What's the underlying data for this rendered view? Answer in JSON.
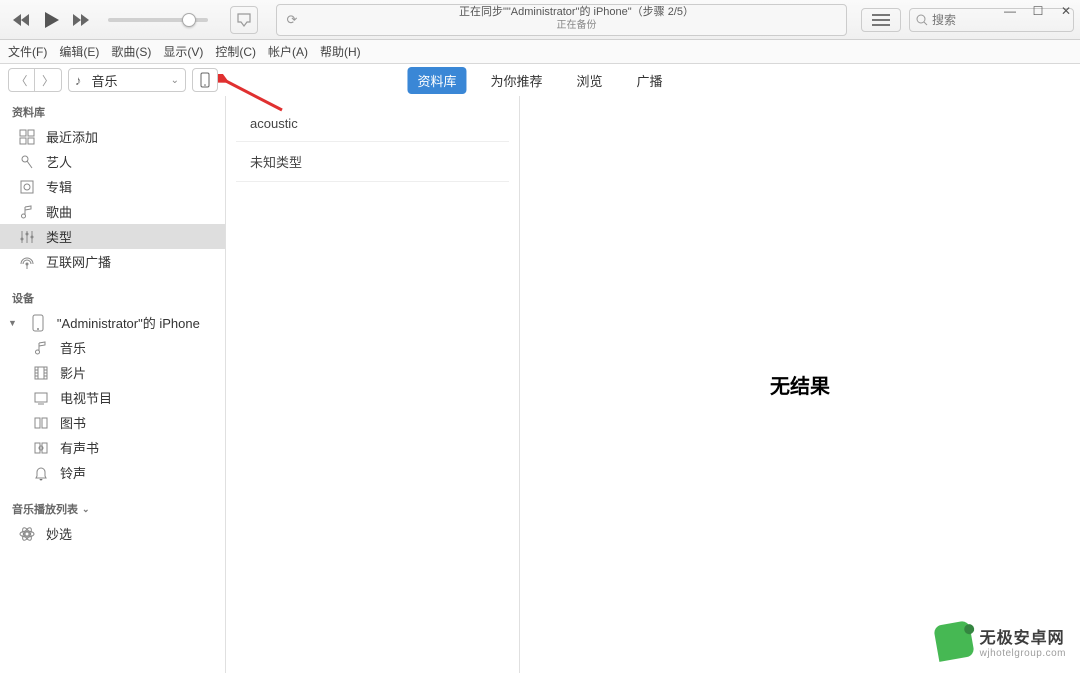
{
  "status": {
    "title": "正在同步\"\"Administrator\"的 iPhone\"（步骤 2/5）",
    "subtitle": "正在备份"
  },
  "search": {
    "placeholder": "搜索"
  },
  "menubar": [
    "文件(F)",
    "编辑(E)",
    "歌曲(S)",
    "显示(V)",
    "控制(C)",
    "帐户(A)",
    "帮助(H)"
  ],
  "mediaSelect": {
    "label": "音乐"
  },
  "tabs": [
    {
      "label": "资料库",
      "active": true
    },
    {
      "label": "为你推荐",
      "active": false
    },
    {
      "label": "浏览",
      "active": false
    },
    {
      "label": "广播",
      "active": false
    }
  ],
  "sidebar": {
    "libraryHeader": "资料库",
    "library": [
      {
        "key": "recent",
        "label": "最近添加",
        "icon": "grid"
      },
      {
        "key": "artists",
        "label": "艺人",
        "icon": "mic"
      },
      {
        "key": "albums",
        "label": "专辑",
        "icon": "album"
      },
      {
        "key": "songs",
        "label": "歌曲",
        "icon": "note"
      },
      {
        "key": "genres",
        "label": "类型",
        "icon": "tuner",
        "selected": true
      },
      {
        "key": "radio",
        "label": "互联网广播",
        "icon": "radio"
      }
    ],
    "devicesHeader": "设备",
    "device": {
      "label": "\"Administrator\"的 iPhone"
    },
    "deviceChildren": [
      {
        "key": "dmusic",
        "label": "音乐",
        "icon": "note"
      },
      {
        "key": "dmovies",
        "label": "影片",
        "icon": "film"
      },
      {
        "key": "dtv",
        "label": "电视节目",
        "icon": "tv"
      },
      {
        "key": "dbooks",
        "label": "图书",
        "icon": "book"
      },
      {
        "key": "daudio",
        "label": "有声书",
        "icon": "abook"
      },
      {
        "key": "dring",
        "label": "铃声",
        "icon": "bell"
      }
    ],
    "playlistHeader": "音乐播放列表",
    "playlists": [
      {
        "key": "genius",
        "label": "妙选",
        "icon": "genius"
      }
    ]
  },
  "genres": [
    "acoustic",
    "未知类型"
  ],
  "results": {
    "empty": "无结果"
  },
  "watermark": {
    "title": "无极安卓网",
    "sub": "wjhotelgroup.com"
  }
}
